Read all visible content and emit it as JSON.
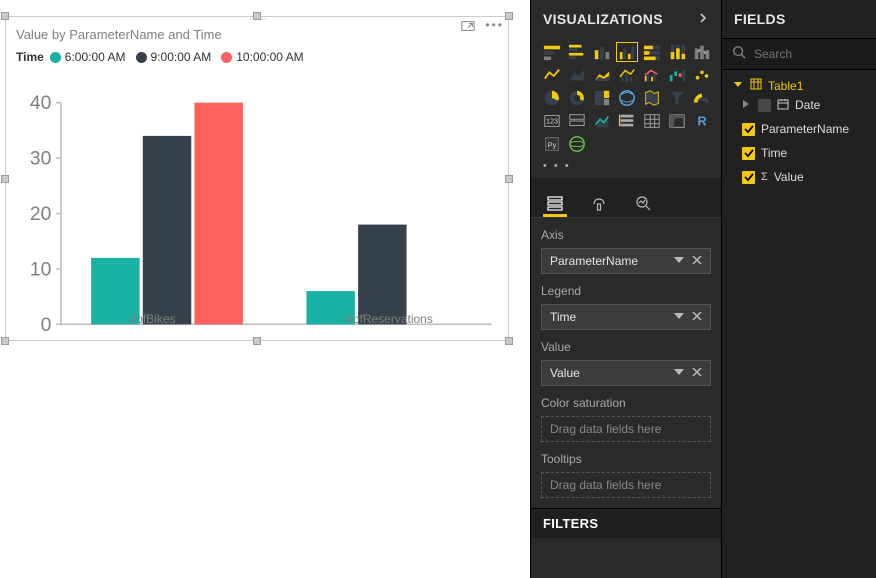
{
  "visual": {
    "title": "Value by ParameterName and Time",
    "legend_title": "Time",
    "legend": [
      {
        "label": "6:00:00 AM",
        "color": "#19b1a3"
      },
      {
        "label": "9:00:00 AM",
        "color": "#37414b"
      },
      {
        "label": "10:00:00 AM",
        "color": "#fd625e"
      }
    ]
  },
  "chart_data": {
    "type": "bar",
    "title": "Value by ParameterName and Time",
    "xlabel": "",
    "ylabel": "",
    "categories": [
      "#ofBikes",
      "#ofReservations"
    ],
    "series": [
      {
        "name": "6:00:00 AM",
        "color": "#19b1a3",
        "values": [
          12,
          6
        ]
      },
      {
        "name": "9:00:00 AM",
        "color": "#37414b",
        "values": [
          34,
          18
        ]
      },
      {
        "name": "10:00:00 AM",
        "color": "#fd625e",
        "values": [
          40,
          null
        ]
      }
    ],
    "ylim": [
      0,
      40
    ],
    "yticks": [
      0,
      10,
      20,
      30,
      40
    ]
  },
  "viz_panel": {
    "header": "VISUALIZATIONS",
    "gallery_more": "• • •",
    "wells": {
      "axis": {
        "label": "Axis",
        "value": "ParameterName"
      },
      "legend": {
        "label": "Legend",
        "value": "Time"
      },
      "value": {
        "label": "Value",
        "value": "Value"
      },
      "color": {
        "label": "Color saturation",
        "placeholder": "Drag data fields here"
      },
      "tooltips": {
        "label": "Tooltips",
        "placeholder": "Drag data fields here"
      }
    },
    "filters_header": "FILTERS"
  },
  "fields_panel": {
    "header": "FIELDS",
    "search_placeholder": "Search",
    "table": "Table1",
    "fields": {
      "date": "Date",
      "parameter_name": "ParameterName",
      "time": "Time",
      "value": "Value"
    }
  }
}
